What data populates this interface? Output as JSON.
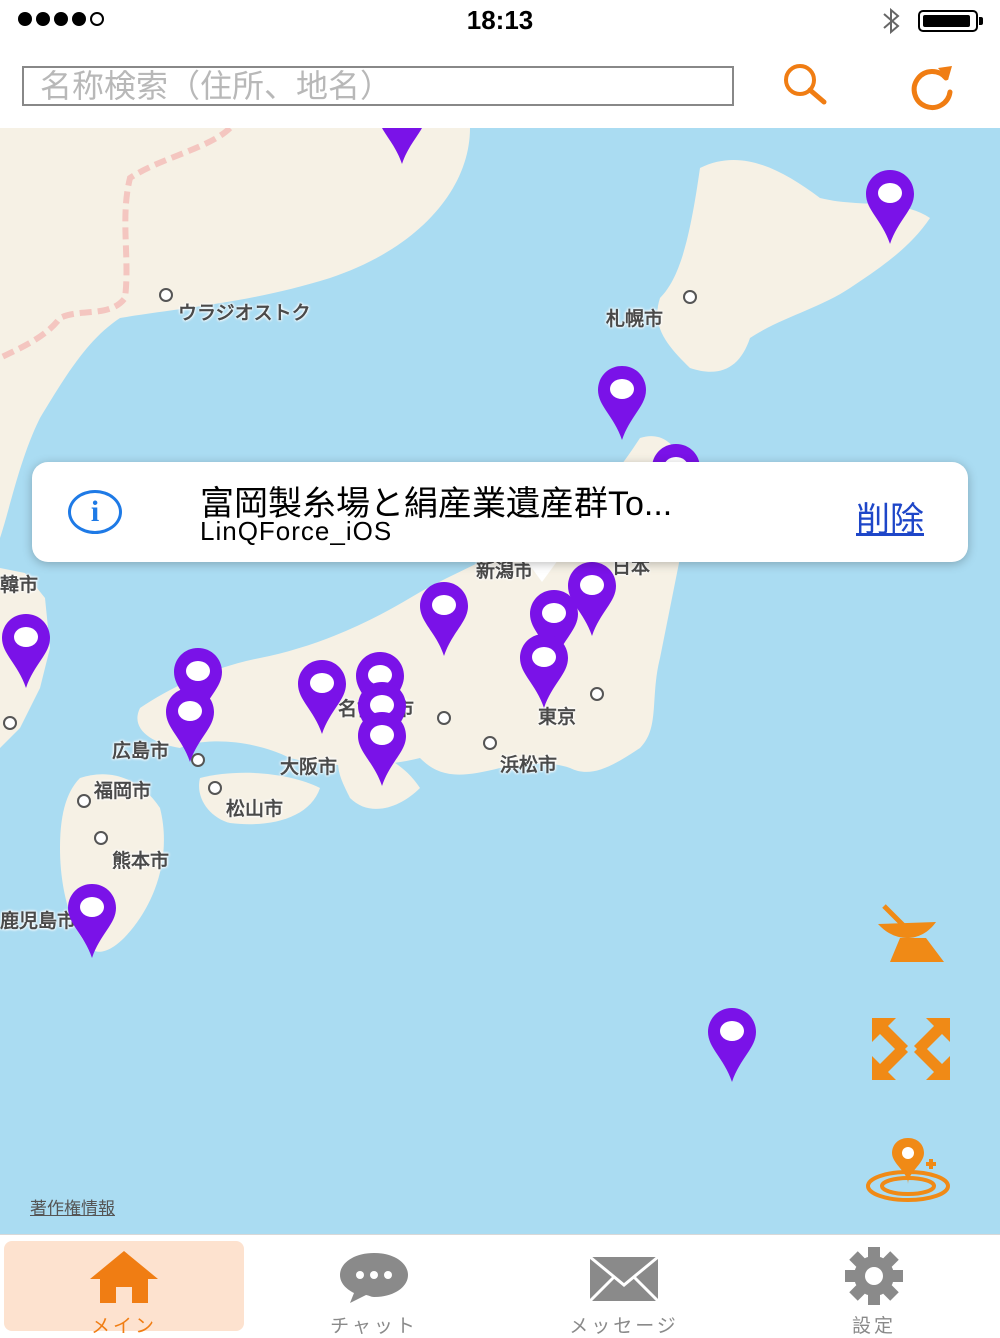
{
  "status_bar": {
    "time": "18:13",
    "signal_bars": 4,
    "battery_percent": 90
  },
  "search": {
    "placeholder": "名称検索（住所、地名）",
    "search_icon": "magnifier-icon",
    "refresh_icon": "refresh-icon"
  },
  "map": {
    "cities": [
      "ウラジオストク",
      "札幌市",
      "新潟市",
      "日本",
      "東京",
      "浜松市",
      "名古屋市",
      "大阪市",
      "広島市",
      "福岡市",
      "松山市",
      "熊本市",
      "鹿児島市",
      "韓市"
    ],
    "copyright": "著作権情報",
    "pin_color": "#7a12e8"
  },
  "callout": {
    "title": "富岡製糸場と絹産業遺産群To...",
    "subtitle": "LinQForce_iOS",
    "delete_label": "削除"
  },
  "controls": {
    "satellite_icon": "satellite-dish-icon",
    "expand_icon": "expand-arrows-icon",
    "location_icon": "add-location-icon"
  },
  "tabs": [
    {
      "label": "メイン",
      "icon": "home-icon",
      "active": true
    },
    {
      "label": "チャット",
      "icon": "chat-bubble-icon",
      "active": false
    },
    {
      "label": "メッセージ",
      "icon": "envelope-icon",
      "active": false
    },
    {
      "label": "設定",
      "icon": "gear-icon",
      "active": false
    }
  ],
  "colors": {
    "accent": "#f07d13",
    "link": "#1e46c8",
    "sea": "#aadcf2",
    "land": "#f6f1e5"
  }
}
